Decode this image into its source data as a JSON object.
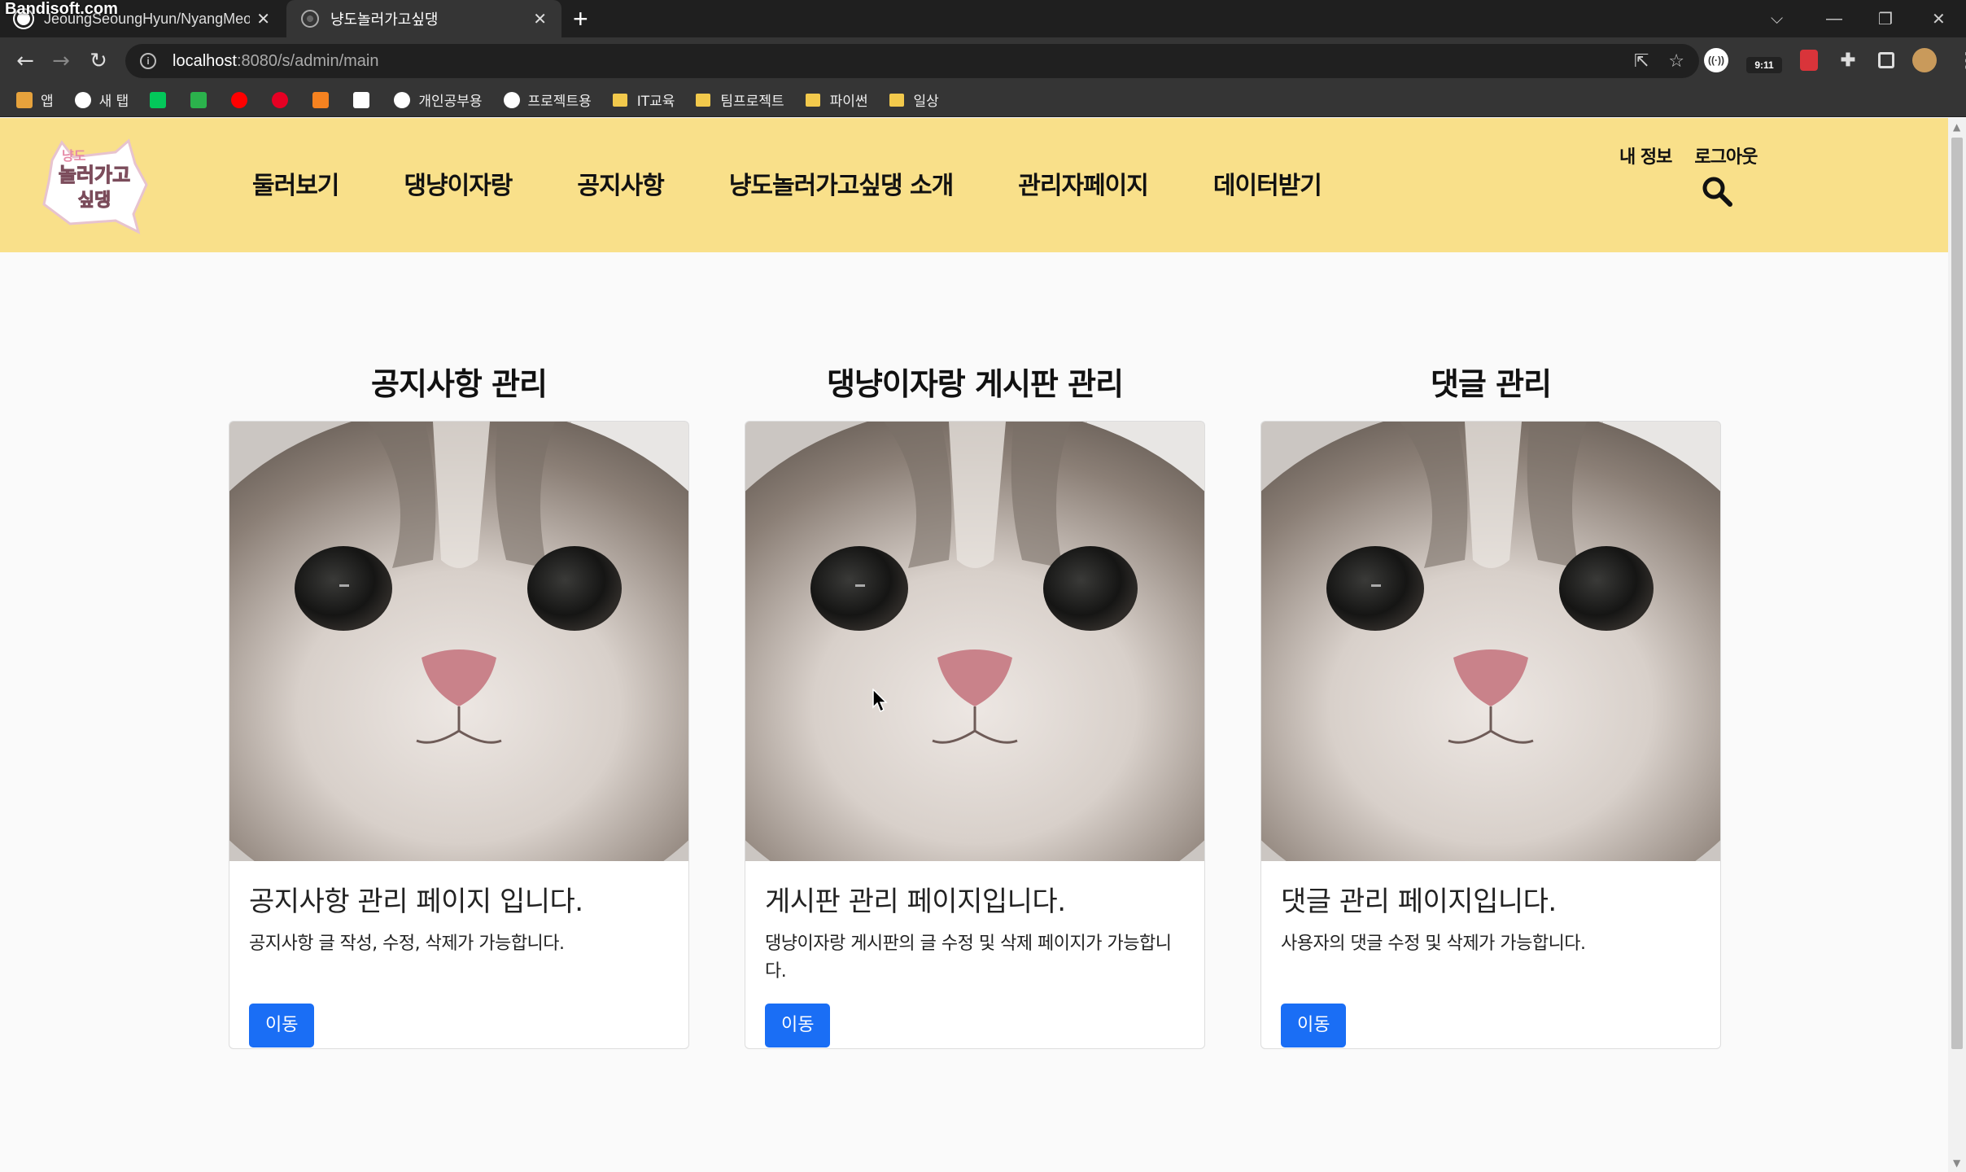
{
  "browser": {
    "watermark": "Bandisoft.com",
    "tabs": [
      {
        "title": "JeoungSeoungHyun/NyangMeo",
        "active": false
      },
      {
        "title": "냥도놀러가고싶댕",
        "active": true
      }
    ],
    "new_tab": "+",
    "window_controls": {
      "tab_search": "⌵",
      "minimize": "—",
      "restore": "❐",
      "close": "✕"
    },
    "url_host": "localhost",
    "url_path": ":8080/s/admin/main",
    "extension_badge": "9:11",
    "bookmarks": [
      {
        "label": "앱",
        "icon": "apps-grid-icon",
        "color": "#e6a23c"
      },
      {
        "label": "새 탭",
        "icon": "globe-icon",
        "color": "#ffffff"
      },
      {
        "label": "",
        "icon": "naver-icon",
        "color": "#03c75a"
      },
      {
        "label": "",
        "icon": "line-icon",
        "color": "#2bb24c"
      },
      {
        "label": "",
        "icon": "youtube-icon",
        "color": "#ff0000"
      },
      {
        "label": "",
        "icon": "pinterest-icon",
        "color": "#e60023"
      },
      {
        "label": "",
        "icon": "puzzle-orange-icon",
        "color": "#f58220"
      },
      {
        "label": "",
        "icon": "trello-icon",
        "color": "#ffffff"
      },
      {
        "label": "개인공부용",
        "icon": "github-icon",
        "color": "#ffffff"
      },
      {
        "label": "프로젝트용",
        "icon": "github-icon",
        "color": "#ffffff"
      },
      {
        "label": "IT교육",
        "icon": "folder-icon",
        "color": "#f2c94c"
      },
      {
        "label": "팀프로젝트",
        "icon": "folder-icon",
        "color": "#f2c94c"
      },
      {
        "label": "파이썬",
        "icon": "folder-icon",
        "color": "#f2c94c"
      },
      {
        "label": "일상",
        "icon": "folder-icon",
        "color": "#f2c94c"
      }
    ]
  },
  "site": {
    "header_color": "#f9e08a",
    "logo_text": "냥도놀러가고싶댕",
    "nav": [
      "둘러보기",
      "댕냥이자랑",
      "공지사항",
      "냥도놀러가고싶댕 소개",
      "관리자페이지",
      "데이터받기"
    ],
    "user_links": [
      "내 정보",
      "로그아웃"
    ]
  },
  "cards": [
    {
      "heading": "공지사항 관리",
      "title": "공지사항 관리 페이지 입니다.",
      "text": "공지사항 글 작성, 수정, 삭제가 가능합니다.",
      "button": "이동"
    },
    {
      "heading": "댕냥이자랑 게시판 관리",
      "title": "게시판 관리 페이지입니다.",
      "text": "댕냥이자랑 게시판의 글 수정 및 삭제 페이지가 가능합니다.",
      "button": "이동"
    },
    {
      "heading": "댓글 관리",
      "title": "댓글 관리 페이지입니다.",
      "text": "사용자의 댓글 수정 및 삭제가 가능합니다.",
      "button": "이동"
    }
  ],
  "button_color": "#1a6ef5"
}
